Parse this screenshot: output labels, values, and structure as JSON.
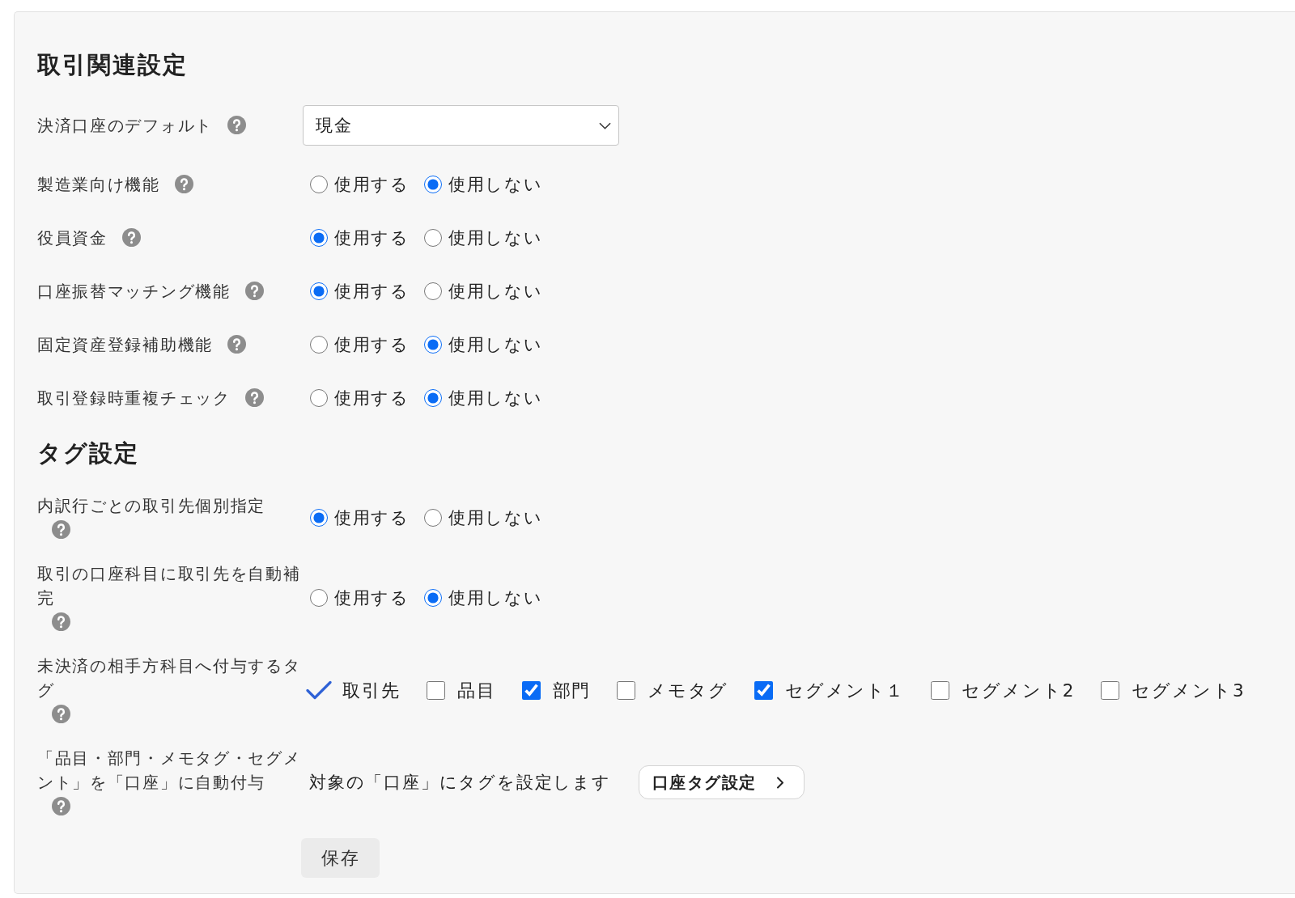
{
  "sections": [
    {
      "title": "取引関連設定",
      "settings": [
        {
          "kind": "select",
          "label": "決済口座のデフォルト",
          "help": true,
          "value": "現金"
        },
        {
          "kind": "radio",
          "label": "製造業向け機能",
          "help": true,
          "options": [
            {
              "label": "使用する",
              "selected": false
            },
            {
              "label": "使用しない",
              "selected": true
            }
          ]
        },
        {
          "kind": "radio",
          "label": "役員資金",
          "help": true,
          "options": [
            {
              "label": "使用する",
              "selected": true
            },
            {
              "label": "使用しない",
              "selected": false
            }
          ]
        },
        {
          "kind": "radio",
          "label": "口座振替マッチング機能",
          "help": true,
          "options": [
            {
              "label": "使用する",
              "selected": true
            },
            {
              "label": "使用しない",
              "selected": false
            }
          ]
        },
        {
          "kind": "radio",
          "label": "固定資産登録補助機能",
          "help": true,
          "options": [
            {
              "label": "使用する",
              "selected": false
            },
            {
              "label": "使用しない",
              "selected": true
            }
          ]
        },
        {
          "kind": "radio",
          "label": "取引登録時重複チェック",
          "help": true,
          "options": [
            {
              "label": "使用する",
              "selected": false
            },
            {
              "label": "使用しない",
              "selected": true
            }
          ]
        }
      ]
    },
    {
      "title": "タグ設定",
      "settings": [
        {
          "kind": "radio",
          "label": "内訳行ごとの取引先個別指定",
          "help": true,
          "options": [
            {
              "label": "使用する",
              "selected": true
            },
            {
              "label": "使用しない",
              "selected": false
            }
          ]
        },
        {
          "kind": "radio",
          "label": "取引の口座科目に取引先を自動補完",
          "help": true,
          "options": [
            {
              "label": "使用する",
              "selected": false
            },
            {
              "label": "使用しない",
              "selected": true
            }
          ]
        },
        {
          "kind": "checklist",
          "label": "未決済の相手方科目へ付与するタグ",
          "help": true,
          "items": [
            {
              "kind": "fixed",
              "label": "取引先"
            },
            {
              "kind": "checkbox",
              "label": "品目",
              "checked": false
            },
            {
              "kind": "checkbox",
              "label": "部門",
              "checked": true
            },
            {
              "kind": "checkbox",
              "label": "メモタグ",
              "checked": false
            },
            {
              "kind": "checkbox",
              "label": "セグメント１",
              "checked": true
            },
            {
              "kind": "checkbox",
              "label": "セグメント2",
              "checked": false
            },
            {
              "kind": "checkbox",
              "label": "セグメント3",
              "checked": false
            }
          ]
        },
        {
          "kind": "link",
          "label": "「品目・部門・メモタグ・セグメント」を「口座」に自動付与",
          "help": true,
          "description": "対象の「口座」にタグを設定します",
          "button": "口座タグ設定"
        }
      ]
    }
  ],
  "save_button": "保存"
}
